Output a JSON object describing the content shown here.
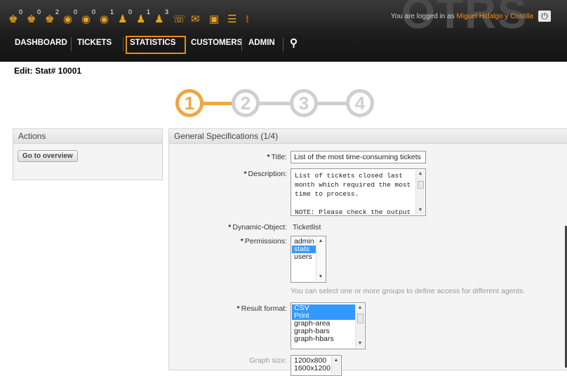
{
  "header": {
    "toolbar": [
      {
        "icon": "locked-ticket-icon",
        "count": "0"
      },
      {
        "icon": "locked-ticket-new-icon",
        "count": "0"
      },
      {
        "icon": "locked-ticket-reached-icon",
        "count": "2"
      },
      {
        "icon": "watched-ticket-icon",
        "count": "0"
      },
      {
        "icon": "watched-ticket-new-icon",
        "count": "0"
      },
      {
        "icon": "watched-ticket-reached-icon",
        "count": "1"
      },
      {
        "icon": "responsible-ticket-icon",
        "count": "0"
      },
      {
        "icon": "responsible-ticket-new-icon",
        "count": "1"
      },
      {
        "icon": "responsible-ticket-reached-icon",
        "count": "3"
      },
      {
        "icon": "new-phone-ticket-icon",
        "count": ""
      },
      {
        "icon": "new-email-ticket-icon",
        "count": ""
      },
      {
        "icon": "new-process-ticket-icon",
        "count": ""
      },
      {
        "icon": "ticket-list-icon",
        "count": ""
      },
      {
        "icon": "escalation-icon",
        "count": ""
      }
    ],
    "logged_in_prefix": "You are logged in as",
    "user_name": "Miguel Hidalgo y Costilla",
    "logo_watermark": "OTRS",
    "nav": [
      "DASHBOARD",
      "TICKETS",
      "STATISTICS",
      "CUSTOMERS",
      "ADMIN"
    ],
    "nav_selected": "STATISTICS"
  },
  "page_title": "Edit: Stat# 10001",
  "steps": [
    "1",
    "2",
    "3",
    "4"
  ],
  "active_step": "1",
  "actions": {
    "heading": "Actions",
    "overview_button": "Go to overview"
  },
  "general": {
    "heading": "General Specifications (1/4)",
    "title_label": "Title:",
    "title_value": "List of the most time-consuming tickets",
    "description_label": "Description:",
    "description_value": "List of tickets closed last\nmonth which required the most\ntime to process.\n\nNOTE: Please check the output",
    "dynamic_object_label": "Dynamic-Object:",
    "dynamic_object_value": "Ticketlist",
    "permissions_label": "Permissions:",
    "permissions_options": [
      {
        "label": "admin",
        "selected": false
      },
      {
        "label": "stats",
        "selected": true
      },
      {
        "label": "users",
        "selected": false
      }
    ],
    "permissions_hint": "You can select one or more groups to define access for different agents.",
    "result_format_label": "Result format:",
    "result_format_options": [
      {
        "label": "CSV",
        "selected": true
      },
      {
        "label": "Print",
        "selected": true
      },
      {
        "label": "graph-area",
        "selected": false
      },
      {
        "label": "graph-bars",
        "selected": false
      },
      {
        "label": "graph-hbars",
        "selected": false
      }
    ],
    "graph_size_label": "Graph size:",
    "graph_size_options": [
      {
        "label": "1200x800",
        "selected": false
      },
      {
        "label": "1600x1200",
        "selected": false
      }
    ]
  },
  "colors": {
    "accent": "#f1a63f",
    "nav_selected_border": "#e88a1a",
    "selection": "#3399ff"
  }
}
